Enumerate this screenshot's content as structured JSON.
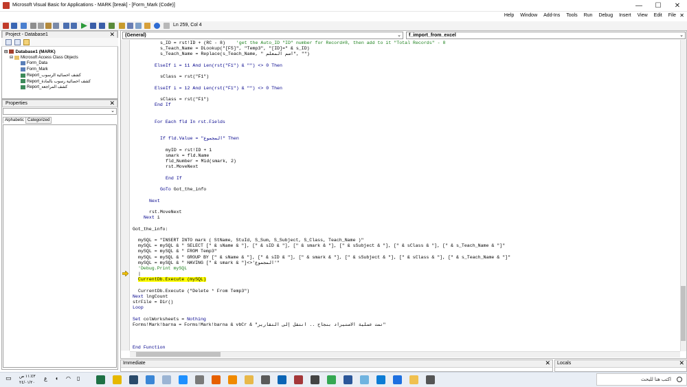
{
  "window": {
    "title": "Microsoft Visual Basic for Applications - MARK [break] - [Form_Mark (Code)]",
    "controls": [
      "—",
      "☐",
      "✕"
    ]
  },
  "menu": {
    "items": [
      "Help",
      "Window",
      "Add-Ins",
      "Tools",
      "Run",
      "Debug",
      "Insert",
      "View",
      "Edit",
      "File"
    ],
    "close_glyph": "✕"
  },
  "toolbar": {
    "position": "Ln 259, Col 4"
  },
  "project": {
    "title": "Project - Database1",
    "root": "Database1 (MARK)",
    "folder": "Microsoft Access Class Objects",
    "items": [
      {
        "label": "Form_Data",
        "kind": "form"
      },
      {
        "label": "Form_Mark",
        "kind": "form"
      },
      {
        "label": "Report_كشف احصائية الرسوب",
        "kind": "report"
      },
      {
        "label": "Report_كشف احصائية رسوب بالمادة",
        "kind": "report"
      },
      {
        "label": "Report_كشف المراجعة",
        "kind": "report"
      }
    ]
  },
  "properties": {
    "title": "Properties",
    "tabs": [
      "Alphabetic",
      "Categorized"
    ]
  },
  "code_window": {
    "object_combo": "(General)",
    "proc_combo": "f_import_from_excel",
    "lines": [
      {
        "i": 0,
        "ind": 10,
        "parts": [
          {
            "t": "s_ID = rst!ID + (RC - 8)    "
          },
          {
            "t": "'get the Auto_ID \"ID\" number for Record#8, then add to it \"Total Records\" - 8",
            "c": "cm"
          }
        ]
      },
      {
        "i": 1,
        "ind": 10,
        "parts": [
          {
            "t": "s_Teach_Name = DLookup(\"[F5]\", \"Temp3\", \"[ID]=\" & s_ID)"
          }
        ]
      },
      {
        "i": 2,
        "ind": 10,
        "parts": [
          {
            "t": "s_Teach_Name = Replace(s_Teach_Name, \" اسم المعلم\", \"\")"
          }
        ]
      },
      {
        "i": 4,
        "ind": 8,
        "parts": [
          {
            "t": "ElseIf i = 11 And Len(rst(\"F1\") & \"\") <> 0 Then",
            "c": "kw"
          }
        ]
      },
      {
        "i": 6,
        "ind": 10,
        "parts": [
          {
            "t": "sClass = rst(\"F1\")"
          }
        ]
      },
      {
        "i": 8,
        "ind": 8,
        "parts": [
          {
            "t": "ElseIf i = 12 And Len(rst(\"F1\") & \"\") <> 0 Then",
            "c": "kw"
          }
        ]
      },
      {
        "i": 10,
        "ind": 10,
        "parts": [
          {
            "t": "sClass = rst(\"F1\")"
          }
        ]
      },
      {
        "i": 11,
        "ind": 8,
        "parts": [
          {
            "t": "End If",
            "c": "kw"
          }
        ]
      },
      {
        "i": 14,
        "ind": 8,
        "parts": [
          {
            "t": "For Each fld In rst.Fields",
            "c": "kw"
          }
        ]
      },
      {
        "i": 17,
        "ind": 10,
        "parts": [
          {
            "t": "If fld.Value = \"المجموع\" Then",
            "c": "kw"
          }
        ]
      },
      {
        "i": 19,
        "ind": 12,
        "parts": [
          {
            "t": "myID = rst!ID + 1"
          }
        ]
      },
      {
        "i": 20,
        "ind": 12,
        "parts": [
          {
            "t": "smark = fld.Name"
          }
        ]
      },
      {
        "i": 21,
        "ind": 12,
        "parts": [
          {
            "t": "fld_Number = Mid(smark, 2)"
          }
        ]
      },
      {
        "i": 22,
        "ind": 12,
        "parts": [
          {
            "t": "rst.MoveNext"
          }
        ]
      },
      {
        "i": 24,
        "ind": 12,
        "parts": [
          {
            "t": "End If",
            "c": "kw"
          }
        ]
      },
      {
        "i": 26,
        "ind": 10,
        "parts": [
          {
            "t": "GoTo",
            "c": "kw"
          },
          {
            "t": " Got_the_info"
          }
        ]
      },
      {
        "i": 28,
        "ind": 6,
        "parts": [
          {
            "t": "Next",
            "c": "kw"
          }
        ]
      },
      {
        "i": 30,
        "ind": 6,
        "parts": [
          {
            "t": "rst.MoveNext"
          }
        ]
      },
      {
        "i": 31,
        "ind": 4,
        "parts": [
          {
            "t": "Next",
            "c": "kw"
          },
          {
            "t": " i"
          }
        ]
      },
      {
        "i": 33,
        "ind": 0,
        "parts": [
          {
            "t": "Got_the_info:"
          }
        ]
      },
      {
        "i": 35,
        "ind": 2,
        "parts": [
          {
            "t": "mySQL = \"INSERT INTO mark ( StName, StuId, S_Sum, S_Subject, S_Class, Teach_Name )\""
          }
        ]
      },
      {
        "i": 36,
        "ind": 2,
        "parts": [
          {
            "t": "mySQL = mySQL & \" SELECT [\" & sName & \"], [\" & sID & \"], [\" & smark & \"], [\" & sSubject & \"], [\" & sClass & \"], [\" & s_Teach_Name & \"]\""
          }
        ]
      },
      {
        "i": 37,
        "ind": 2,
        "parts": [
          {
            "t": "mySQL = mySQL & \" FROM Temp3\""
          }
        ]
      },
      {
        "i": 38,
        "ind": 2,
        "parts": [
          {
            "t": "mySQL = mySQL & \" GROUP BY [\" & sName & \"], [\" & sID & \"], [\" & smark & \"], [\" & sSubject & \"], [\" & sClass & \"], [\" & s_Teach_Name & \"]\""
          }
        ]
      },
      {
        "i": 39,
        "ind": 2,
        "parts": [
          {
            "t": "mySQL = mySQL & \" HAVING [\" & smark & \"]<>'المجموع'\""
          }
        ]
      },
      {
        "i": 40,
        "ind": 2,
        "parts": [
          {
            "t": "'Debug.Print mySQL",
            "c": "cm"
          }
        ]
      },
      {
        "i": 41,
        "ind": 2,
        "parts": [
          {
            "t": "|"
          }
        ]
      },
      {
        "i": 42,
        "ind": 2,
        "parts": [
          {
            "t": "CurrentDb.Execute (mySQL)",
            "c": "hl"
          }
        ]
      },
      {
        "i": 44,
        "ind": 2,
        "parts": [
          {
            "t": "CurrentDb.Execute (\"Delete * From Temp3\")"
          }
        ]
      },
      {
        "i": 45,
        "ind": 0,
        "parts": [
          {
            "t": "Next",
            "c": "kw"
          },
          {
            "t": " lngCount"
          }
        ]
      },
      {
        "i": 46,
        "ind": 0,
        "parts": [
          {
            "t": "strFile = Dir()"
          }
        ]
      },
      {
        "i": 47,
        "ind": 0,
        "parts": [
          {
            "t": "Loop",
            "c": "kw"
          }
        ]
      },
      {
        "i": 49,
        "ind": 0,
        "parts": [
          {
            "t": "Set",
            "c": "kw"
          },
          {
            "t": " colWorksheets = "
          },
          {
            "t": "Nothing",
            "c": "kw"
          }
        ]
      },
      {
        "i": 50,
        "ind": 0,
        "parts": [
          {
            "t": "Forms!Mark!barna = Forms!Mark!barna & vbCr & \"تمت عملية الاستيراد بنجاح .. انتقل إلى التقارير\""
          }
        ]
      },
      {
        "i": 54,
        "ind": 0,
        "parts": [
          {
            "t": "End Function",
            "c": "kw"
          }
        ]
      }
    ]
  },
  "immediate": {
    "title": "Immediate"
  },
  "locals": {
    "title": "Locals"
  },
  "taskbar": {
    "time": "١١:٤٣ ص",
    "date": "٢٤/٠١/٢٠",
    "search_placeholder": "اكتب هنا للبحث"
  },
  "colors": {
    "keyword": "#00008b",
    "comment": "#1a7f1a",
    "highlight": "#ffff00",
    "exec_arrow": "#f0c000"
  }
}
